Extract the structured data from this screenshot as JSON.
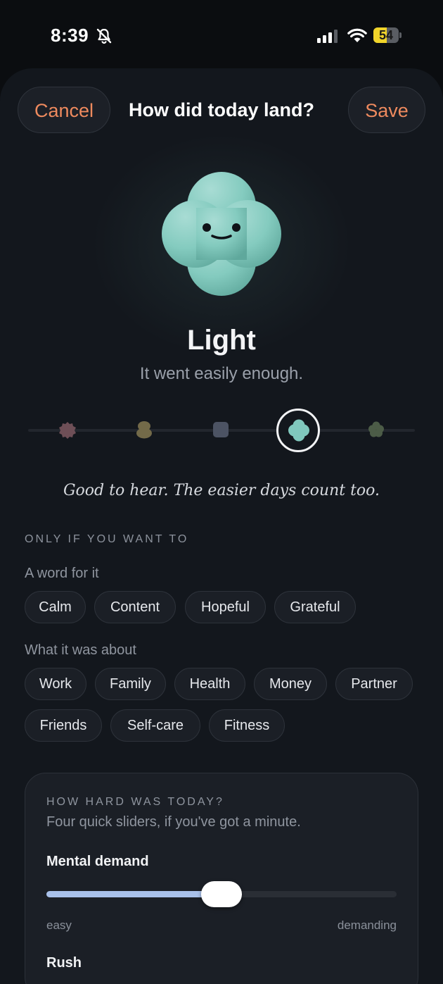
{
  "status_bar": {
    "time": "8:39",
    "battery": "54",
    "battery_level": 0.54,
    "icons": [
      "bell-slash-icon",
      "cellular-signal-icon",
      "wifi-icon",
      "battery-icon"
    ]
  },
  "header": {
    "cancel_label": "Cancel",
    "title": "How did today land?",
    "save_label": "Save"
  },
  "mood": {
    "title": "Light",
    "subtitle": "It went easily enough.",
    "message": "Good to hear. The easier days count too.",
    "selected_index": 3,
    "stops": [
      {
        "icon": "mood-heavy-icon",
        "color": "#6e4f57"
      },
      {
        "icon": "mood-low-icon",
        "color": "#736a49"
      },
      {
        "icon": "mood-neutral-icon",
        "color": "#4c5363"
      },
      {
        "icon": "mood-light-icon",
        "color": "#80c8bd"
      },
      {
        "icon": "mood-bright-icon",
        "color": "#4c5c47"
      }
    ]
  },
  "optional": {
    "section_label": "ONLY IF YOU WANT TO",
    "word_label": "A word for it",
    "words": [
      "Calm",
      "Content",
      "Hopeful",
      "Grateful"
    ],
    "about_label": "What it was about",
    "topics": [
      "Work",
      "Family",
      "Health",
      "Money",
      "Partner",
      "Friends",
      "Self-care",
      "Fitness"
    ]
  },
  "workload": {
    "title": "HOW HARD WAS TODAY?",
    "subtitle": "Four quick sliders, if you've got a minute.",
    "sliders": [
      {
        "label": "Mental demand",
        "min_label": "easy",
        "max_label": "demanding",
        "value": 0.5
      },
      {
        "label": "Rush"
      }
    ]
  },
  "colors": {
    "accent": "#ee8a5e",
    "mood_light": "#80c8bd",
    "slider_fill": "#a9c1ea",
    "background": "#13171d"
  }
}
